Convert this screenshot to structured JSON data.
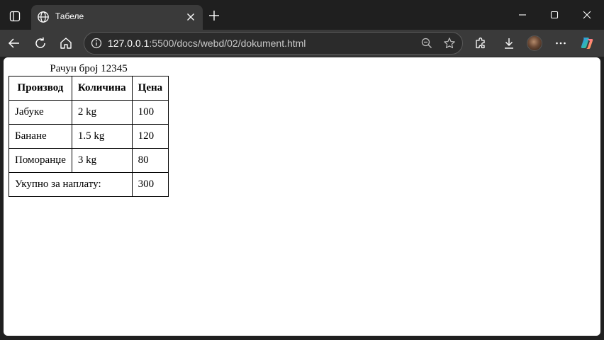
{
  "browser": {
    "tab": {
      "title": "Табеле",
      "favicon": "globe-icon"
    },
    "address": {
      "host": "127.0.0.1",
      "path": ":5500/docs/webd/02/dokument.html"
    },
    "window_controls": [
      "minimize-icon",
      "maximize-icon",
      "close-icon"
    ],
    "toolbar_icons": [
      "back-icon",
      "reload-icon",
      "home-icon",
      "zoom-icon",
      "favorite-star-icon",
      "extensions-icon",
      "downloads-icon",
      "profile-avatar",
      "more-icon",
      "copilot-icon"
    ],
    "colors": {
      "frame": "#202020",
      "toolbar": "#3a3a3a",
      "address_bg": "#2b2b2b",
      "content_bg": "#ffffff"
    }
  },
  "document": {
    "caption": "Рачун број 12345",
    "headers": [
      "Производ",
      "Количина",
      "Цена"
    ],
    "rows": [
      [
        "Јабуке",
        "2 kg",
        "100"
      ],
      [
        "Банане",
        "1.5 kg",
        "120"
      ],
      [
        "Поморанџе",
        "3 kg",
        "80"
      ]
    ],
    "total": {
      "label": "Укупно за наплату:",
      "value": "300"
    }
  }
}
